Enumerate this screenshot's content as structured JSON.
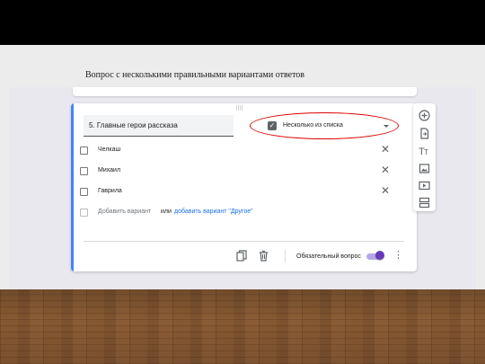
{
  "slide": {
    "title": "Вопрос с несколькими правильными вариантами ответов"
  },
  "question": {
    "title": "5. Главные герои рассказа",
    "type_label": "Несколько из списка",
    "options": [
      {
        "label": "Челкаш"
      },
      {
        "label": "Михаил"
      },
      {
        "label": "Гаврила"
      }
    ],
    "add_option": "Добавить вариант",
    "or": "или",
    "add_other": "добавить вариант \"Другое\"",
    "required_label": "Обязательный вопрос",
    "required": true
  },
  "toolbar": {
    "icons": [
      "add-question-icon",
      "import-questions-icon",
      "add-title-icon",
      "add-image-icon",
      "add-video-icon",
      "add-section-icon"
    ]
  },
  "colors": {
    "accent": "#4285f4",
    "toggle": "#673ab7",
    "link": "#1a73e8",
    "highlight": "#dd0000"
  }
}
